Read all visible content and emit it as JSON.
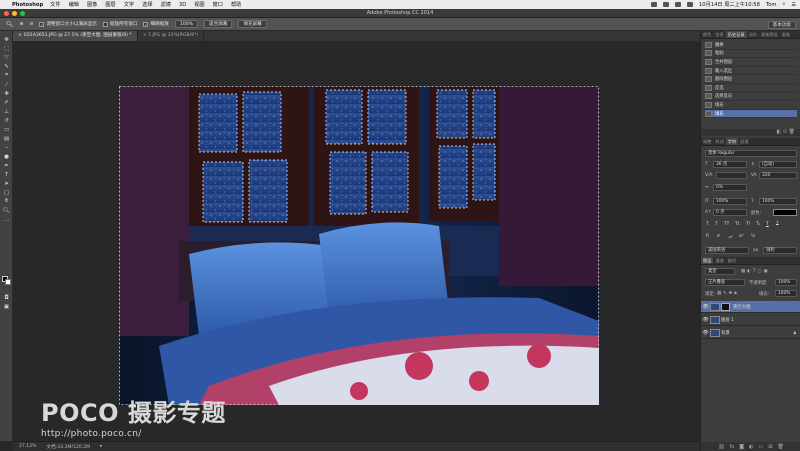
{
  "menubar": {
    "app": "Photoshop",
    "menus": [
      "文件",
      "编辑",
      "图像",
      "图层",
      "文字",
      "选择",
      "滤镜",
      "3D",
      "视图",
      "窗口",
      "帮助"
    ],
    "clock": "10月14日 周二上午10:58",
    "user": "Tom"
  },
  "window": {
    "title": "Adobe Photoshop CC 2014"
  },
  "options": {
    "opt1": "调整窗口大小以满屏显示",
    "opt2": "缩放所有窗口",
    "opt3": "细微缩放",
    "btn100": "100%",
    "btn_fit": "适合屏幕",
    "btn_fill": "填充屏幕",
    "workspace": "基本功能"
  },
  "tabs": [
    {
      "label": "1D1A3051.JPG @ 27.1% (夜空大图, 图层蒙版/8) *"
    },
    {
      "label": "7.JPG @ 33%(RGB/8*)"
    }
  ],
  "status": {
    "zoom": "27.12%",
    "doc": "文档:34.2M/120.2M"
  },
  "watermark": {
    "brand": "POCO 摄影专题",
    "url": "http://photo.poco.cn/"
  },
  "history": {
    "tabs": [
      "颜色",
      "信息",
      "历史记录",
      "动作",
      "画笔预设",
      "画笔"
    ],
    "items": [
      {
        "label": "魔棒"
      },
      {
        "label": "粘贴"
      },
      {
        "label": "合并图层"
      },
      {
        "label": "载入选区"
      },
      {
        "label": "删除图层"
      },
      {
        "label": "反选"
      },
      {
        "label": "选择反向"
      },
      {
        "label": "填充"
      },
      {
        "label": "填充"
      }
    ]
  },
  "character": {
    "tabs": [
      "调整",
      "样式",
      "字符",
      "段落"
    ],
    "font": "黑体",
    "style": "Regular",
    "size": "36 点",
    "leading": "(自动)",
    "tracking": "320",
    "kerning": "0%",
    "vscale": "100%",
    "hscale": "100%",
    "baseline": "0 点",
    "color_label": "颜色:",
    "type_buttons": [
      "T",
      "T",
      "TT",
      "Tt",
      "T¹",
      "T₁",
      "T",
      "T"
    ],
    "lang": "美国英语",
    "aa": "锐利"
  },
  "layers": {
    "tabs": [
      "图层",
      "通道",
      "路径"
    ],
    "kind": "类型",
    "blend": "正片叠底",
    "opacity_label": "不透明度:",
    "opacity": "100%",
    "lock_label": "锁定:",
    "fill_label": "填充:",
    "fill": "100%",
    "items": [
      {
        "name": "夜空大图",
        "selected": true
      },
      {
        "name": "图层 1",
        "selected": false
      },
      {
        "name": "背景",
        "selected": false
      }
    ]
  },
  "tools": [
    "move",
    "marquee",
    "lasso",
    "quick-select",
    "crop",
    "eyedropper",
    "healing",
    "brush",
    "clone",
    "history-brush",
    "eraser",
    "gradient",
    "blur",
    "dodge",
    "pen",
    "type",
    "path-select",
    "shape",
    "hand",
    "zoom"
  ]
}
